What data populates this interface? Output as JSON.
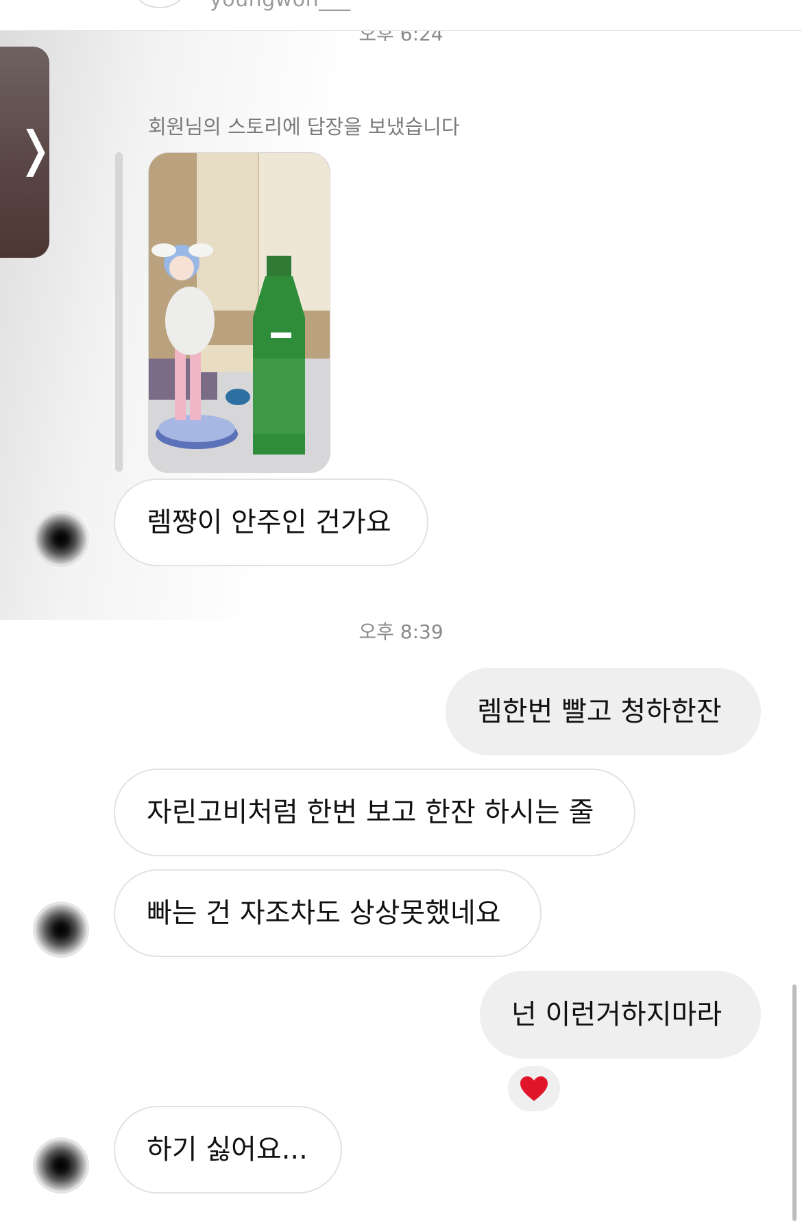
{
  "header": {
    "username": "youngwon___"
  },
  "timestamps": {
    "first": "오후 6:24",
    "second": "오후 8:39"
  },
  "story_reply": {
    "note": "회원님의 스토리에 답장을 보냈습니다"
  },
  "messages": [
    {
      "from": "them",
      "text": "렘쨩이 안주인 건가요"
    },
    {
      "from": "me",
      "text": "렘한번 빨고 청하한잔"
    },
    {
      "from": "them",
      "text": "자린고비처럼 한번 보고 한잔 하시는 줄"
    },
    {
      "from": "them",
      "text": "빠는 건 자조차도 상상못했네요"
    },
    {
      "from": "me",
      "text": "넌 이런거하지마라",
      "reaction": "heart"
    },
    {
      "from": "them",
      "text": "하기 싫어요..."
    }
  ],
  "colors": {
    "sent_bubble": "#efefef",
    "recv_border": "#e2e2e2",
    "heart": "#e0152a"
  },
  "icons": {
    "side_tab": "chevron-right-icon",
    "reaction": "heart-icon"
  }
}
